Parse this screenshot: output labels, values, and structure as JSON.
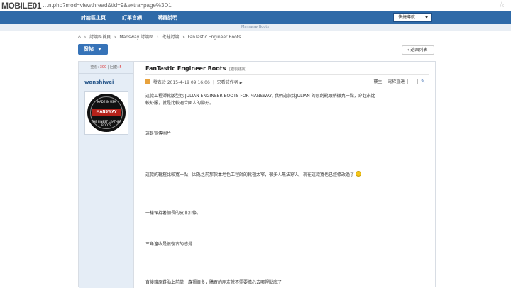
{
  "browser": {
    "logo": "MOBILE01",
    "url": "…n.php?mod=viewthread&tid=9&extra=page%3D1",
    "star_icon": "star-icon"
  },
  "topnav": {
    "items": [
      "討論區主頁",
      "訂單官網",
      "購買說明"
    ],
    "quicknav": "快捷導航",
    "search_placeholder": "Mansway Boots"
  },
  "breadcrumb": [
    "討論區首頁",
    "Mansway 討論區",
    "靴鞋討論",
    "FanTastic Engineer Boots"
  ],
  "post_button": "發帖",
  "back_button": "返回列表",
  "stats": {
    "view_label": "查看:",
    "views": "300",
    "reply_label": "回復:",
    "replies": "5"
  },
  "author": {
    "name": "wanshiwei",
    "avatar_top": "MADE IN USA",
    "avatar_band": "MANSWAY",
    "avatar_bottom": "THE FINEST LEATHER BOOTS"
  },
  "post": {
    "title": "FanTastic Engineer Boots",
    "copy_link": "[複製鏈接]",
    "posted_label": "發表於",
    "posted_at": "2015-4-19 09:16:06",
    "author_only": "只看該作者",
    "floor_label": "樓主",
    "direct_label": "電梯直達",
    "paragraphs": [
      "這款工程師靴版型也 JULIAN ENGINEER BOOTS FOR MANSWAY, 我們這款比JULIAN 的原創靴頭稍微寬一點，穿起來比",
      "較舒服，就是比較適合國人的腳形。",
      "這是宣傳圖片",
      "這款的靴楦比較寬一點，因為之前那款本地色工程師的靴楦太窄，很多人無法穿入，現在這款寬也已經修改過了",
      "一樣保持著加長的皮革扣條。",
      "三角邊收是很復古的感覺",
      "直接鑲原鞋貼上前掌，森褶很多，購買的朋友就不需要擔心去哪裡貼底了"
    ]
  },
  "colors": {
    "nav_blue": "#2f6aa8",
    "sidebar_bg": "#e5edf6",
    "accent_red": "#d33333"
  }
}
